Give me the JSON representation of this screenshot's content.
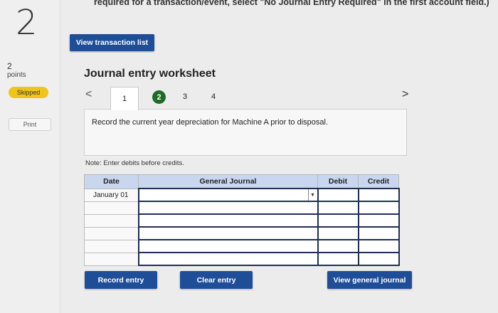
{
  "sidebar": {
    "question_number": "2",
    "points_value": "2",
    "points_label": "points",
    "skipped_label": "Skipped",
    "print_label": "Print"
  },
  "header": {
    "instruction_text": "required for a transaction/event, select \"No Journal Entry Required\" in the first account field.)"
  },
  "buttons": {
    "view_transaction_list": "View transaction list",
    "record_entry": "Record entry",
    "clear_entry": "Clear entry",
    "view_general_journal": "View general journal"
  },
  "worksheet": {
    "title": "Journal entry worksheet",
    "nav_prev": "<",
    "nav_next": ">",
    "tabs": [
      {
        "label": "1",
        "state": "active"
      },
      {
        "label": "2",
        "state": "completed",
        "color": "#1e6b28"
      },
      {
        "label": "3",
        "state": "default"
      },
      {
        "label": "4",
        "state": "default"
      }
    ],
    "description": "Record the current year depreciation for Machine A prior to disposal.",
    "note": "Note: Enter debits before credits."
  },
  "table": {
    "columns": [
      "Date",
      "General Journal",
      "Debit",
      "Credit"
    ],
    "rows": [
      {
        "date": "January 01",
        "account": "",
        "debit": "",
        "credit": ""
      },
      {
        "date": "",
        "account": "",
        "debit": "",
        "credit": ""
      },
      {
        "date": "",
        "account": "",
        "debit": "",
        "credit": ""
      },
      {
        "date": "",
        "account": "",
        "debit": "",
        "credit": ""
      },
      {
        "date": "",
        "account": "",
        "debit": "",
        "credit": ""
      },
      {
        "date": "",
        "account": "",
        "debit": "",
        "credit": ""
      }
    ]
  },
  "colors": {
    "primary_button": "#1f4e99",
    "header_row": "#c9d7ee",
    "skipped_badge": "#f0c419",
    "completed_tab": "#1e6b28"
  }
}
